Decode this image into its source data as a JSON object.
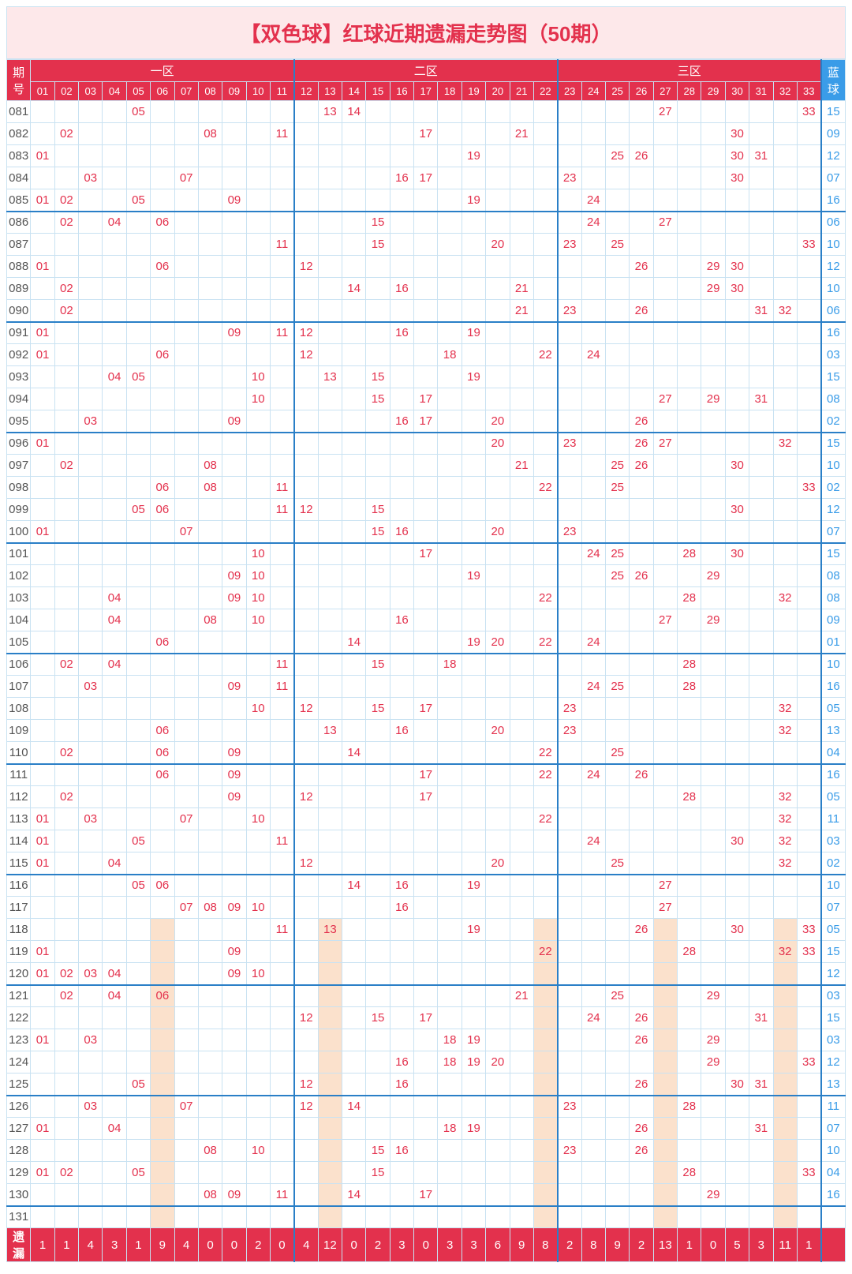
{
  "title": "【双色球】红球近期遗漏走势图（50期）",
  "zones": [
    "一区",
    "二区",
    "三区"
  ],
  "period_label": "期号",
  "blue_label": "蓝球",
  "footer_label": "遗漏",
  "chart_data": {
    "type": "table",
    "red_numbers": [
      "01",
      "02",
      "03",
      "04",
      "05",
      "06",
      "07",
      "08",
      "09",
      "10",
      "11",
      "12",
      "13",
      "14",
      "15",
      "16",
      "17",
      "18",
      "19",
      "20",
      "21",
      "22",
      "23",
      "24",
      "25",
      "26",
      "27",
      "28",
      "29",
      "30",
      "31",
      "32",
      "33"
    ],
    "rows": [
      {
        "period": "081",
        "reds": [
          "05",
          "13",
          "14",
          "27",
          "33"
        ],
        "blue": "15"
      },
      {
        "period": "082",
        "reds": [
          "02",
          "08",
          "11",
          "17",
          "21",
          "30"
        ],
        "blue": "09"
      },
      {
        "period": "083",
        "reds": [
          "01",
          "19",
          "25",
          "26",
          "30",
          "31"
        ],
        "blue": "12"
      },
      {
        "period": "084",
        "reds": [
          "03",
          "07",
          "16",
          "17",
          "23",
          "30"
        ],
        "blue": "07"
      },
      {
        "period": "085",
        "reds": [
          "01",
          "02",
          "05",
          "09",
          "19",
          "24"
        ],
        "blue": "16"
      },
      {
        "period": "086",
        "reds": [
          "02",
          "04",
          "06",
          "15",
          "24",
          "27"
        ],
        "blue": "06"
      },
      {
        "period": "087",
        "reds": [
          "11",
          "15",
          "20",
          "23",
          "25",
          "33"
        ],
        "blue": "10"
      },
      {
        "period": "088",
        "reds": [
          "01",
          "06",
          "12",
          "26",
          "29",
          "30"
        ],
        "blue": "12"
      },
      {
        "period": "089",
        "reds": [
          "02",
          "14",
          "16",
          "21",
          "29",
          "30"
        ],
        "blue": "10"
      },
      {
        "period": "090",
        "reds": [
          "02",
          "21",
          "23",
          "26",
          "31",
          "32"
        ],
        "blue": "06"
      },
      {
        "period": "091",
        "reds": [
          "01",
          "09",
          "11",
          "12",
          "16",
          "19"
        ],
        "blue": "16"
      },
      {
        "period": "092",
        "reds": [
          "01",
          "06",
          "12",
          "18",
          "22",
          "24"
        ],
        "blue": "03"
      },
      {
        "period": "093",
        "reds": [
          "04",
          "05",
          "10",
          "13",
          "15",
          "19"
        ],
        "blue": "15"
      },
      {
        "period": "094",
        "reds": [
          "10",
          "15",
          "17",
          "27",
          "29",
          "31"
        ],
        "blue": "08"
      },
      {
        "period": "095",
        "reds": [
          "03",
          "09",
          "16",
          "17",
          "20",
          "26"
        ],
        "blue": "02"
      },
      {
        "period": "096",
        "reds": [
          "01",
          "20",
          "23",
          "26",
          "27",
          "32"
        ],
        "blue": "15"
      },
      {
        "period": "097",
        "reds": [
          "02",
          "08",
          "21",
          "25",
          "26",
          "30"
        ],
        "blue": "10"
      },
      {
        "period": "098",
        "reds": [
          "06",
          "08",
          "11",
          "22",
          "25",
          "33"
        ],
        "blue": "02"
      },
      {
        "period": "099",
        "reds": [
          "05",
          "06",
          "11",
          "12",
          "15",
          "30"
        ],
        "blue": "12"
      },
      {
        "period": "100",
        "reds": [
          "01",
          "07",
          "15",
          "16",
          "20",
          "23"
        ],
        "blue": "07"
      },
      {
        "period": "101",
        "reds": [
          "10",
          "17",
          "24",
          "25",
          "28",
          "30"
        ],
        "blue": "15"
      },
      {
        "period": "102",
        "reds": [
          "09",
          "10",
          "19",
          "25",
          "26",
          "29"
        ],
        "blue": "08"
      },
      {
        "period": "103",
        "reds": [
          "04",
          "09",
          "10",
          "22",
          "28",
          "32"
        ],
        "blue": "08"
      },
      {
        "period": "104",
        "reds": [
          "04",
          "08",
          "10",
          "16",
          "27",
          "29"
        ],
        "blue": "09"
      },
      {
        "period": "105",
        "reds": [
          "06",
          "14",
          "19",
          "20",
          "22",
          "24"
        ],
        "blue": "01"
      },
      {
        "period": "106",
        "reds": [
          "02",
          "04",
          "11",
          "15",
          "18",
          "28"
        ],
        "blue": "10"
      },
      {
        "period": "107",
        "reds": [
          "03",
          "09",
          "11",
          "24",
          "25",
          "28"
        ],
        "blue": "16"
      },
      {
        "period": "108",
        "reds": [
          "10",
          "12",
          "15",
          "17",
          "23",
          "32"
        ],
        "blue": "05"
      },
      {
        "period": "109",
        "reds": [
          "06",
          "13",
          "16",
          "20",
          "23",
          "32"
        ],
        "blue": "13"
      },
      {
        "period": "110",
        "reds": [
          "02",
          "06",
          "09",
          "14",
          "22",
          "25"
        ],
        "blue": "04"
      },
      {
        "period": "111",
        "reds": [
          "06",
          "09",
          "17",
          "22",
          "24",
          "26"
        ],
        "blue": "16"
      },
      {
        "period": "112",
        "reds": [
          "02",
          "09",
          "12",
          "17",
          "28",
          "32"
        ],
        "blue": "05"
      },
      {
        "period": "113",
        "reds": [
          "01",
          "03",
          "07",
          "10",
          "22",
          "32"
        ],
        "blue": "11"
      },
      {
        "period": "114",
        "reds": [
          "01",
          "05",
          "11",
          "24",
          "30",
          "32"
        ],
        "blue": "03"
      },
      {
        "period": "115",
        "reds": [
          "01",
          "04",
          "12",
          "20",
          "25",
          "32"
        ],
        "blue": "02"
      },
      {
        "period": "116",
        "reds": [
          "05",
          "06",
          "14",
          "16",
          "19",
          "27"
        ],
        "blue": "10"
      },
      {
        "period": "117",
        "reds": [
          "07",
          "08",
          "09",
          "10",
          "16",
          "27"
        ],
        "blue": "07"
      },
      {
        "period": "118",
        "reds": [
          "11",
          "13",
          "19",
          "26",
          "30",
          "33"
        ],
        "blue": "05"
      },
      {
        "period": "119",
        "reds": [
          "01",
          "09",
          "22",
          "28",
          "32",
          "33"
        ],
        "blue": "15"
      },
      {
        "period": "120",
        "reds": [
          "01",
          "02",
          "03",
          "04",
          "09",
          "10"
        ],
        "blue": "12"
      },
      {
        "period": "121",
        "reds": [
          "02",
          "04",
          "06",
          "21",
          "25",
          "29"
        ],
        "blue": "03"
      },
      {
        "period": "122",
        "reds": [
          "12",
          "15",
          "17",
          "24",
          "26",
          "31"
        ],
        "blue": "15"
      },
      {
        "period": "123",
        "reds": [
          "01",
          "03",
          "18",
          "19",
          "26",
          "29"
        ],
        "blue": "03"
      },
      {
        "period": "124",
        "reds": [
          "16",
          "18",
          "19",
          "20",
          "29",
          "33"
        ],
        "blue": "12"
      },
      {
        "period": "125",
        "reds": [
          "05",
          "12",
          "16",
          "26",
          "30",
          "31"
        ],
        "blue": "13"
      },
      {
        "period": "126",
        "reds": [
          "03",
          "07",
          "12",
          "14",
          "23",
          "28"
        ],
        "blue": "11"
      },
      {
        "period": "127",
        "reds": [
          "01",
          "04",
          "18",
          "19",
          "26",
          "31"
        ],
        "blue": "07"
      },
      {
        "period": "128",
        "reds": [
          "08",
          "10",
          "15",
          "16",
          "23",
          "26"
        ],
        "blue": "10"
      },
      {
        "period": "129",
        "reds": [
          "01",
          "02",
          "05",
          "15",
          "28",
          "33"
        ],
        "blue": "04"
      },
      {
        "period": "130",
        "reds": [
          "08",
          "09",
          "11",
          "14",
          "17",
          "29"
        ],
        "blue": "16"
      },
      {
        "period": "131",
        "reds": [],
        "blue": ""
      }
    ],
    "footer": [
      "1",
      "1",
      "4",
      "3",
      "1",
      "9",
      "4",
      "0",
      "0",
      "2",
      "0",
      "4",
      "12",
      "0",
      "2",
      "3",
      "0",
      "3",
      "3",
      "6",
      "9",
      "8",
      "2",
      "8",
      "9",
      "2",
      "13",
      "1",
      "0",
      "5",
      "3",
      "11",
      "1"
    ],
    "highlight_cols": [
      "06",
      "13",
      "22",
      "27",
      "32"
    ]
  }
}
